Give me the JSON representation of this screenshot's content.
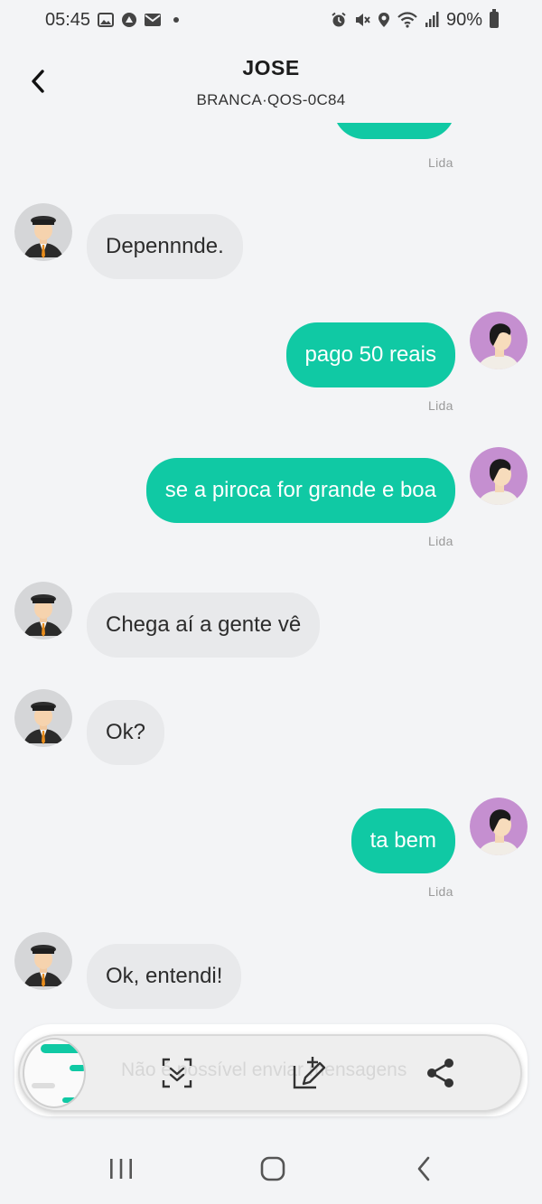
{
  "status_bar": {
    "time": "05:45",
    "battery": "90%",
    "left_icons": [
      "image-icon",
      "app-icon",
      "mail-icon",
      "dot-icon"
    ],
    "right_icons": [
      "alarm-icon",
      "mute-icon",
      "location-icon",
      "wifi-icon",
      "signal-icon",
      "battery-icon"
    ]
  },
  "header": {
    "title": "JOSE",
    "subtitle": "BRANCA·QOS-0C84"
  },
  "colors": {
    "accent": "#10c9a4",
    "incoming_bubble": "#e8e9eb",
    "background": "#f3f4f6",
    "user_avatar_bg": "#c58fd0"
  },
  "messages": [
    {
      "direction": "out",
      "text": "",
      "status": "Lida",
      "partial": true
    },
    {
      "direction": "in",
      "text": "Depennnde."
    },
    {
      "direction": "out",
      "text": "pago 50 reais",
      "status": "Lida"
    },
    {
      "direction": "out",
      "text": "se a piroca for grande e boa",
      "status": "Lida"
    },
    {
      "direction": "in",
      "text": "Chega aí a gente vê"
    },
    {
      "direction": "in",
      "text": "Ok?"
    },
    {
      "direction": "out",
      "text": "ta bem",
      "status": "Lida"
    },
    {
      "direction": "in",
      "text": "Ok, entendi!"
    }
  ],
  "input": {
    "placeholder": "Não é possível enviar mensagens"
  },
  "screenshot_toolbar": {
    "icons": [
      "screenshot-thumbnail",
      "scroll-capture-icon",
      "edit-icon",
      "share-icon"
    ]
  },
  "nav_bar": {
    "icons": [
      "recent-apps-icon",
      "home-icon",
      "back-icon"
    ]
  }
}
